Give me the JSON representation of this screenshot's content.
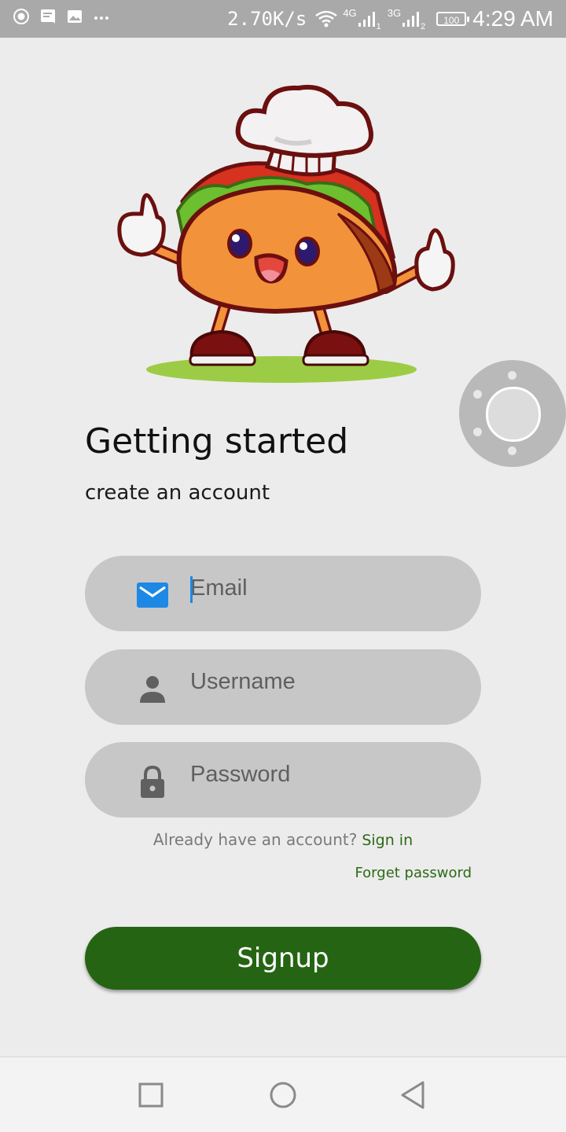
{
  "status_bar": {
    "net_speed": "2.70K/s",
    "net_type_1": "4G",
    "sim_1": "1",
    "net_type_2": "3G",
    "sim_2": "2",
    "battery": "100",
    "time": "4:29 AM",
    "left_icons": [
      "record-icon",
      "message-icon",
      "image-icon",
      "more-icon"
    ],
    "right_icons": [
      "wifi-icon",
      "signal-icon",
      "signal-icon",
      "battery-icon"
    ]
  },
  "mascot": {
    "icon": "taco-chef-mascot",
    "colors": {
      "taco": "#f2923a",
      "outline": "#6b0f0f",
      "lettuce": "#6cbf2f",
      "tomato": "#d7311f",
      "hat": "#f3f1f1",
      "ground": "#9ccc45"
    }
  },
  "assist_button": {
    "icon": "assistive-touch-icon"
  },
  "onboarding": {
    "title": "Getting started",
    "subtitle": "create an account"
  },
  "form": {
    "email": {
      "placeholder": "Email",
      "value": "",
      "icon": "email-icon",
      "icon_color": "#1e88e5"
    },
    "username": {
      "placeholder": "Username",
      "value": "",
      "icon": "person-icon"
    },
    "password": {
      "placeholder": "Password",
      "value": "",
      "icon": "lock-icon"
    }
  },
  "account": {
    "question": "Already have an account?",
    "signin_label": "Sign in",
    "forget_label": "Forget password"
  },
  "signup": {
    "label": "Signup",
    "color": "#256413"
  },
  "nav_bar": {
    "icons": [
      "recent-apps-icon",
      "home-icon",
      "back-icon"
    ]
  }
}
